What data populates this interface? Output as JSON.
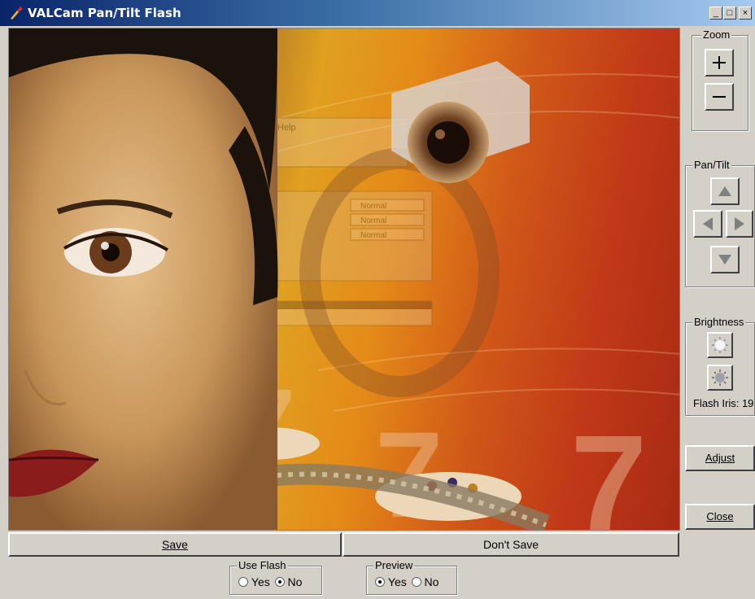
{
  "window": {
    "title": "VALCam Pan/Tilt Flash",
    "minimize_glyph": "_",
    "maximize_glyph": "□",
    "close_glyph": "×"
  },
  "preview_image": {
    "icon": "captured-photo",
    "menu_text": "Help",
    "normal_labels": [
      "Normal",
      "Normal",
      "Normal"
    ],
    "numeral": "7"
  },
  "zoom": {
    "legend": "Zoom",
    "zoom_in_icon": "plus-icon",
    "zoom_out_icon": "minus-icon"
  },
  "pan_tilt": {
    "legend": "Pan/Tilt",
    "up_icon": "arrow-up-icon",
    "left_icon": "arrow-left-icon",
    "right_icon": "arrow-right-icon",
    "down_icon": "arrow-down-icon"
  },
  "brightness": {
    "legend": "Brightness",
    "brighter_icon": "sun-bright-icon",
    "darker_icon": "sun-dim-icon",
    "flash_iris_label": "Flash Iris: 19"
  },
  "buttons": {
    "adjust_label": "Adjust",
    "close_label": "Close",
    "save_label": "Save",
    "dont_save_label": "Don't Save"
  },
  "use_flash": {
    "legend": "Use Flash",
    "yes_label": "Yes",
    "no_label": "No",
    "selected": "No"
  },
  "preview": {
    "legend": "Preview",
    "yes_label": "Yes",
    "no_label": "No",
    "selected": "Yes"
  }
}
